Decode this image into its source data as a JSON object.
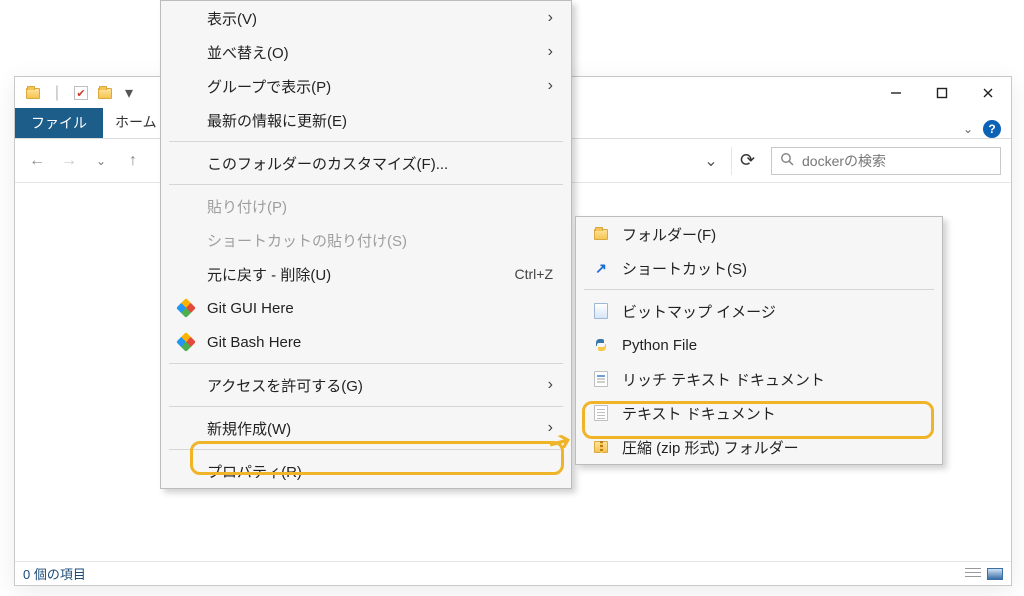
{
  "window": {
    "tabs": {
      "file": "ファイル",
      "home": "ホーム"
    },
    "search_placeholder": "dockerの検索",
    "status": "0 個の項目"
  },
  "context_menu": {
    "view": "表示(V)",
    "sort": "並べ替え(O)",
    "group_by": "グループで表示(P)",
    "refresh": "最新の情報に更新(E)",
    "customize": "このフォルダーのカスタマイズ(F)...",
    "paste": "貼り付け(P)",
    "paste_shortcut": "ショートカットの貼り付け(S)",
    "undo": "元に戻す - 削除(U)",
    "undo_sc": "Ctrl+Z",
    "git_gui": "Git GUI Here",
    "git_bash": "Git Bash Here",
    "give_access": "アクセスを許可する(G)",
    "new": "新規作成(W)",
    "properties": "プロパティ(R)"
  },
  "new_submenu": {
    "folder": "フォルダー(F)",
    "shortcut": "ショートカット(S)",
    "bitmap": "ビットマップ イメージ",
    "python": "Python File",
    "rtf": "リッチ テキスト ドキュメント",
    "text": "テキスト ドキュメント",
    "zip": "圧縮 (zip 形式) フォルダー"
  }
}
